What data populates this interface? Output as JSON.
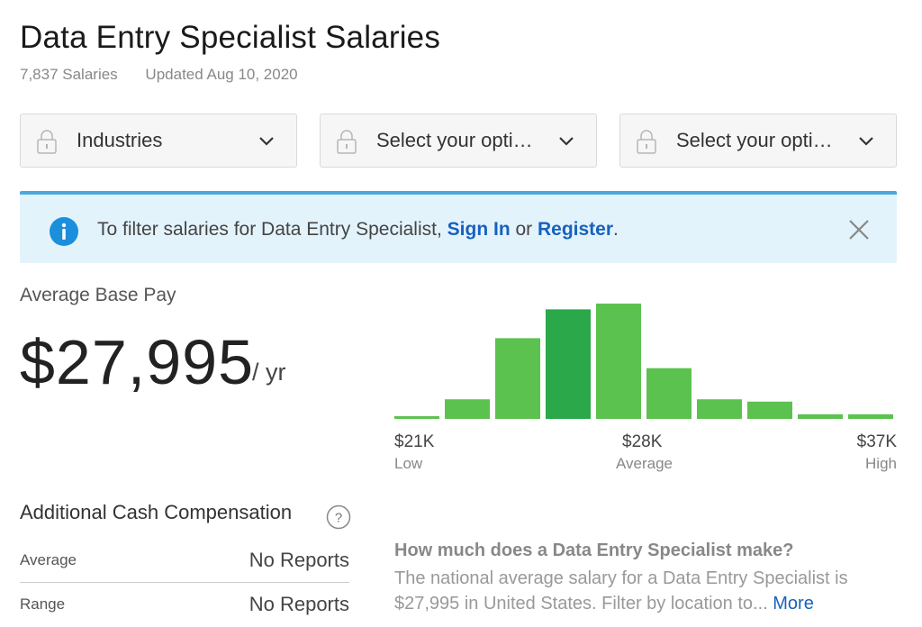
{
  "header": {
    "title": "Data Entry Specialist Salaries",
    "salary_count": "7,837 Salaries",
    "updated": "Updated Aug 10, 2020"
  },
  "filters": [
    {
      "label": "Industries",
      "icon": "lock-icon"
    },
    {
      "label": "Select your opti…",
      "icon": "lock-icon"
    },
    {
      "label": "Select your opti…",
      "icon": "lock-icon"
    }
  ],
  "banner": {
    "text_before": "To filter salaries for Data Entry Specialist, ",
    "sign_in": "Sign In",
    "text_middle": " or ",
    "register": "Register",
    "text_after": ".",
    "accent_color": "#4aa8dd",
    "background": "#e3f3fc"
  },
  "average_pay": {
    "label": "Average Base Pay",
    "value": "$27,995",
    "unit": "/ yr"
  },
  "chart_data": {
    "type": "bar",
    "bar_color": "#5cc24f",
    "highlight_color": "#2aa84a",
    "values": [
      2,
      17,
      70,
      95,
      100,
      44,
      17,
      15,
      4,
      4
    ],
    "highlight_index": 3,
    "x_markers": [
      {
        "value": "$21K",
        "sub": "Low"
      },
      {
        "value": "$28K",
        "sub": "Average"
      },
      {
        "value": "$37K",
        "sub": "High"
      }
    ]
  },
  "additional_cash": {
    "title": "Additional Cash Compensation",
    "rows": [
      {
        "label": "Average",
        "value": "No Reports"
      },
      {
        "label": "Range",
        "value": "No Reports"
      }
    ]
  },
  "faq": {
    "question": "How much does a Data Entry Specialist make?",
    "answer": "The national average salary for a Data Entry Specialist is $27,995 in United States. Filter by location to...",
    "more_link": "More"
  }
}
